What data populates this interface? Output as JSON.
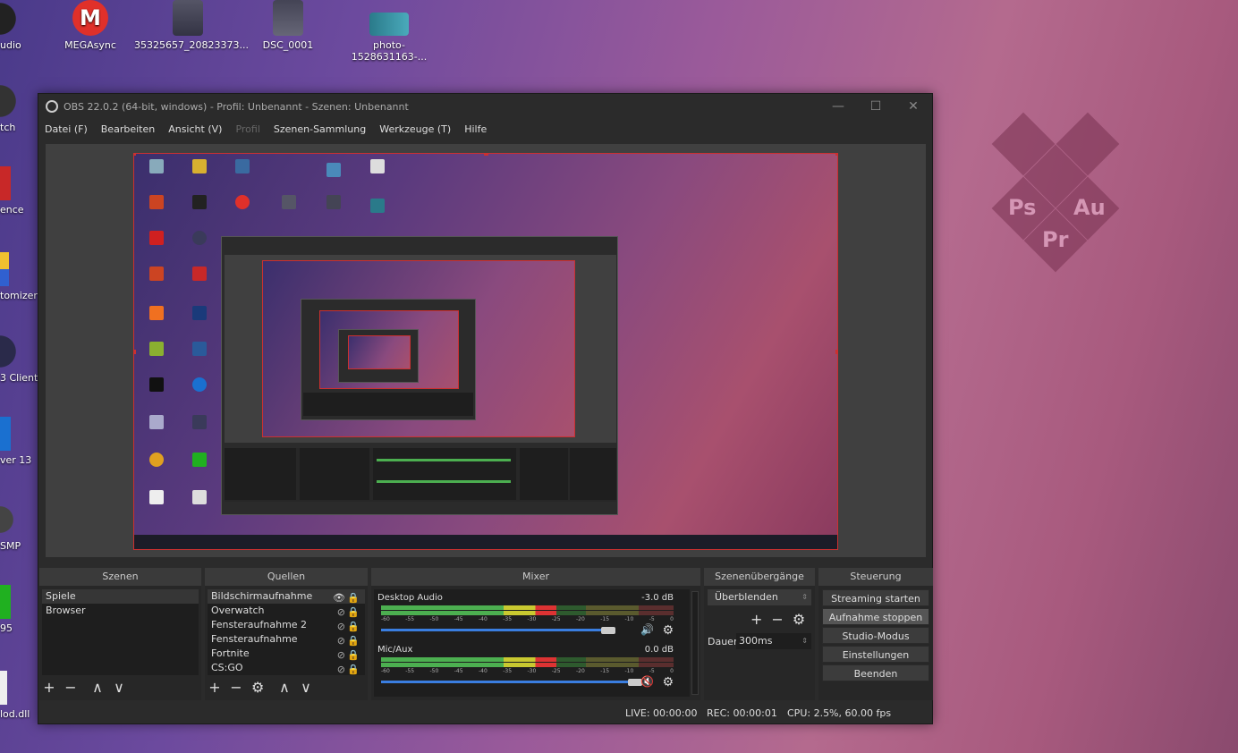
{
  "desktop": {
    "top_icons": [
      {
        "label": "MEGAsync"
      },
      {
        "label": "35325657_20823373..."
      },
      {
        "label": "DSC_0001"
      },
      {
        "label": "photo-1528631163-..."
      }
    ],
    "left_icons": [
      {
        "label": "udio"
      },
      {
        "label": "tch"
      },
      {
        "label": "ence"
      },
      {
        "label": "tomizer"
      },
      {
        "label": "3 Client"
      },
      {
        "label": "ver 13"
      },
      {
        "label": "SMP"
      },
      {
        "label": "95"
      },
      {
        "label": "lod.dll"
      }
    ],
    "logos": {
      "ps": "Ps",
      "au": "Au",
      "pr": "Pr"
    }
  },
  "obs": {
    "title": "OBS 22.0.2 (64-bit, windows) - Profil: Unbenannt - Szenen: Unbenannt",
    "window_controls": {
      "minimize": "—",
      "maximize": "☐",
      "close": "✕"
    },
    "menu": [
      {
        "label": "Datei (F)",
        "enabled": true
      },
      {
        "label": "Bearbeiten",
        "enabled": true
      },
      {
        "label": "Ansicht (V)",
        "enabled": true
      },
      {
        "label": "Profil",
        "enabled": false
      },
      {
        "label": "Szenen-Sammlung",
        "enabled": true
      },
      {
        "label": "Werkzeuge (T)",
        "enabled": true
      },
      {
        "label": "Hilfe",
        "enabled": true
      }
    ],
    "docks": {
      "scenes": {
        "title": "Szenen",
        "items": [
          "Spiele",
          "Browser"
        ],
        "tools": {
          "add": "+",
          "remove": "−",
          "up": "∧",
          "down": "∨"
        }
      },
      "sources": {
        "title": "Quellen",
        "items": [
          "Bildschirmaufnahme",
          "Overwatch",
          "Fensteraufnahme 2",
          "Fensteraufnahme",
          "Fortnite",
          "CS:GO"
        ],
        "tools": {
          "add": "+",
          "remove": "−",
          "settings": "⚙",
          "up": "∧",
          "down": "∨"
        }
      },
      "mixer": {
        "title": "Mixer",
        "tracks": [
          {
            "name": "Desktop Audio",
            "db": "-3.0 dB",
            "level": 0.6
          },
          {
            "name": "Mic/Aux",
            "db": "0.0 dB",
            "level": 0.6
          }
        ],
        "ticks": [
          "-60",
          "-55",
          "-50",
          "-45",
          "-40",
          "-35",
          "-30",
          "-25",
          "-20",
          "-15",
          "-10",
          "-5",
          "0"
        ]
      },
      "transitions": {
        "title": "Szenenübergänge",
        "selected": "Überblenden",
        "duration_label": "Dauer",
        "duration_value": "300ms"
      },
      "controls": {
        "title": "Steuerung",
        "buttons": [
          "Streaming starten",
          "Aufnahme stoppen",
          "Studio-Modus",
          "Einstellungen",
          "Beenden"
        ]
      }
    },
    "status": {
      "live": "LIVE: 00:00:00",
      "rec": "REC: 00:00:01",
      "cpu": "CPU: 2.5%, 60.00 fps"
    }
  }
}
